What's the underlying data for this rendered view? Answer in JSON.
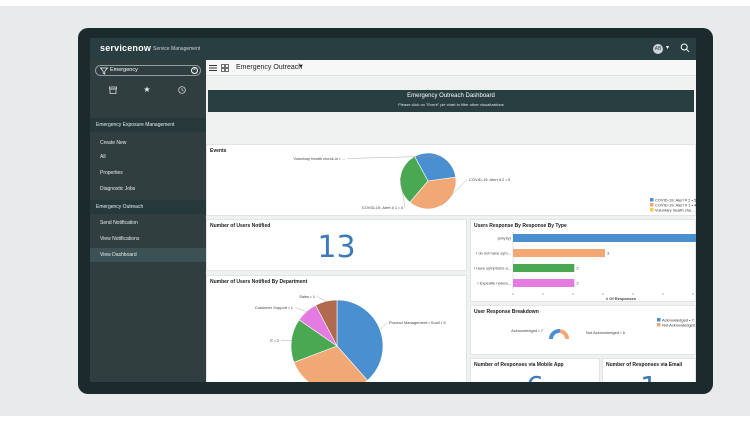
{
  "app": {
    "logo": "servicenow",
    "subtitle": "Service Management",
    "avatar": "AB"
  },
  "sidebar": {
    "filter_value": "Emergency",
    "items": [
      {
        "label": "Emergency Exposure Management",
        "type": "section"
      },
      {
        "label": "Create New",
        "type": "item"
      },
      {
        "label": "All",
        "type": "item"
      },
      {
        "label": "Properties",
        "type": "item"
      },
      {
        "label": "Diagnostic Jobs",
        "type": "item"
      },
      {
        "label": "Emergency Outreach",
        "type": "section"
      },
      {
        "label": "Send Notification",
        "type": "item"
      },
      {
        "label": "View Notifications",
        "type": "item"
      },
      {
        "label": "View Dashboard",
        "type": "item"
      }
    ]
  },
  "content": {
    "dashboard_select": "Emergency Outreach",
    "hero_title": "Emergency Outreach Dashboard",
    "hero_subtitle": "Please click on \"Event\" pie chart to filter other visualizations"
  },
  "panels": {
    "events_title": "Events",
    "users_notified_title": "Number of Users Notified",
    "users_notified_value": "13",
    "by_department_title": "Number of Users Notified By Department",
    "response_by_type_title": "Users Response By Response By Type",
    "breakdown_title": "User Response Breakdown",
    "mobile_title": "Number of Responses via Mobile App",
    "mobile_value": "6",
    "email_title": "Number of Responses via Email",
    "email_value": "1"
  },
  "chart_data": [
    {
      "type": "pie",
      "title": "Events",
      "categories": [
        "Voluntary health check-in • ...",
        "COVID-19: Alert # 2 • 5",
        "COVID-19: Alert # 1 • 4"
      ],
      "values": [
        4,
        5,
        4
      ],
      "colors": [
        "#4a8fd0",
        "#f2a874",
        "#4aa852"
      ],
      "legend": [
        "COVID-19: Alert # 2 • 5",
        "COVID-19: Alert # 1 • 4",
        "Voluntary health che..."
      ],
      "legend_colors": [
        "#4a8fd0",
        "#f2a874",
        "#f2d14a"
      ],
      "legend_position": "bottom-right"
    },
    {
      "type": "pie",
      "title": "Number of Users Notified By Department",
      "categories": [
        "Product Management • Sunil • 5",
        "Development • 4",
        "IT • 2",
        "Customer Support • 1",
        "Sales • 1"
      ],
      "values": [
        5,
        4,
        2,
        1,
        1
      ],
      "colors": [
        "#4a8fd0",
        "#f2a874",
        "#4aa852",
        "#e47be0",
        "#b06a50"
      ]
    },
    {
      "type": "bar",
      "orientation": "horizontal",
      "title": "Users Response By Response By Type",
      "categories": [
        "(empty)",
        "I do not have sym...",
        "I have symptoms a...",
        "I Expedite natura..."
      ],
      "values": [
        6,
        3,
        2,
        2
      ],
      "colors": [
        "#4a8fd0",
        "#f2a874",
        "#4aa852",
        "#e47be0"
      ],
      "xlabel": "# Of Responses"
    },
    {
      "type": "pie",
      "title": "User Response Breakdown",
      "categories": [
        "Acknowledged • 7",
        "Not Acknowledged • 6"
      ],
      "values": [
        7,
        6
      ],
      "colors": [
        "#4a8fd0",
        "#f2a874"
      ],
      "legend": [
        "Acknowledged • 7",
        "Not Acknowledged • 6"
      ],
      "legend_position": "right"
    }
  ]
}
